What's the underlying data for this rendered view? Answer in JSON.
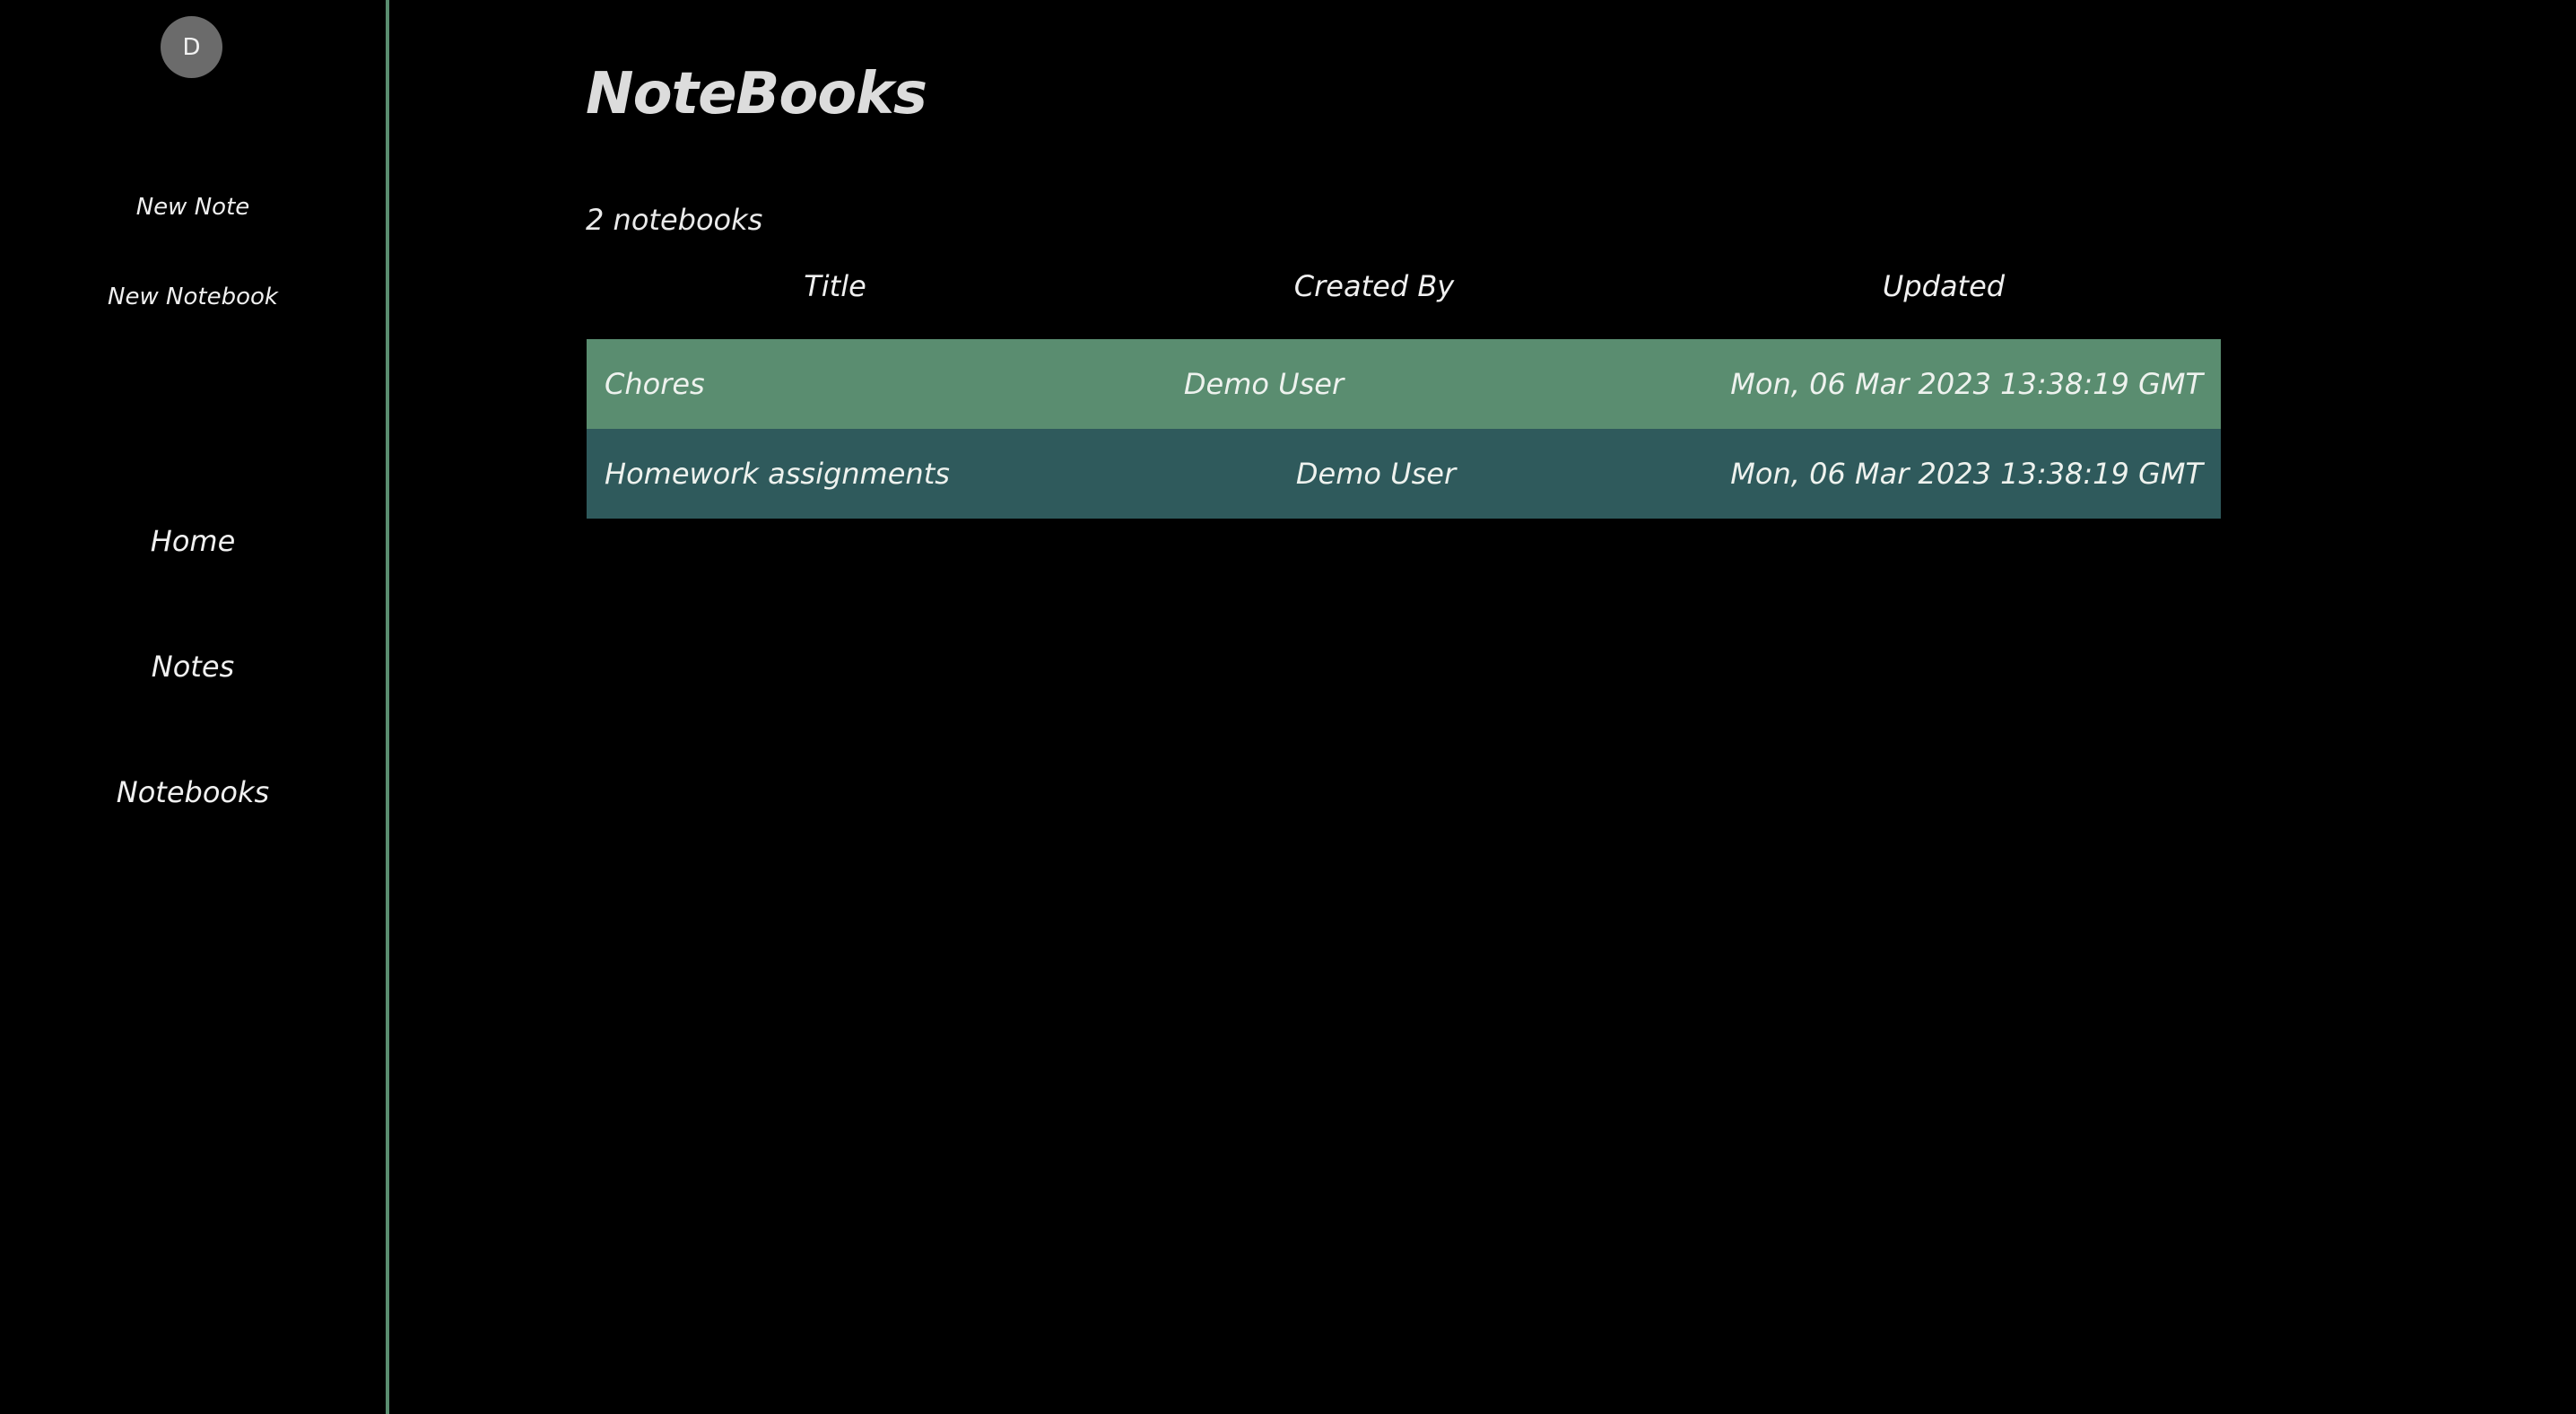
{
  "sidebar": {
    "avatar_initial": "D",
    "actions": {
      "new_note": "New Note",
      "new_notebook": "New Notebook"
    },
    "nav": {
      "home": "Home",
      "notes": "Notes",
      "notebooks": "Notebooks"
    }
  },
  "main": {
    "title": "NoteBooks",
    "count_text": "2 notebooks",
    "table": {
      "headers": [
        "Title",
        "Created By",
        "Updated"
      ],
      "rows": [
        {
          "title": "Chores",
          "created_by": "Demo User",
          "updated": "Mon, 06 Mar 2023 13:38:19 GMT"
        },
        {
          "title": "Homework assignments",
          "created_by": "Demo User",
          "updated": "Mon, 06 Mar 2023 13:38:19 GMT"
        }
      ]
    }
  },
  "colors": {
    "background": "#000000",
    "accent": "#5a8d70",
    "row_alt": "#2f5a5c",
    "avatar": "#6b6b6b"
  }
}
